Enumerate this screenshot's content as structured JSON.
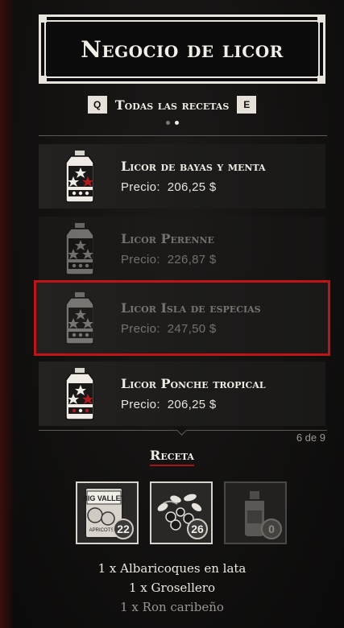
{
  "header": {
    "title": "Negocio de licor"
  },
  "filter": {
    "prev_key": "Q",
    "label": "Todas las recetas",
    "next_key": "E"
  },
  "pagination": {
    "dots": [
      false,
      true
    ],
    "counter": "6 de 9"
  },
  "items": [
    {
      "name": "Licor de bayas y menta",
      "price_label": "Precio:",
      "price": "206,25 $",
      "state": "available"
    },
    {
      "name": "Licor Perenne",
      "price_label": "Precio:",
      "price": "226,87 $",
      "state": "dim"
    },
    {
      "name": "Licor Isla de especias",
      "price_label": "Precio:",
      "price": "247,50 $",
      "state": "selected-dim"
    },
    {
      "name": "Licor Ponche tropical",
      "price_label": "Precio:",
      "price": "206,25 $",
      "state": "available"
    }
  ],
  "recipe": {
    "title": "Receta",
    "ingredients": [
      {
        "icon": "canned-apricots-icon",
        "count": "22",
        "line": "1 x Albaricoques en lata",
        "available": true,
        "tin_text": "BIG VALLEY",
        "tin_sub": "APRICOTS"
      },
      {
        "icon": "currant-berries-icon",
        "count": "26",
        "line": "1 x Grosellero",
        "available": true
      },
      {
        "icon": "rum-bottle-icon",
        "count": "0",
        "line": "1 x Ron caribeño",
        "available": false
      }
    ]
  },
  "colors": {
    "accent_red": "#c01417",
    "underline_red": "#a3171a",
    "frame": "#e9e5de"
  }
}
